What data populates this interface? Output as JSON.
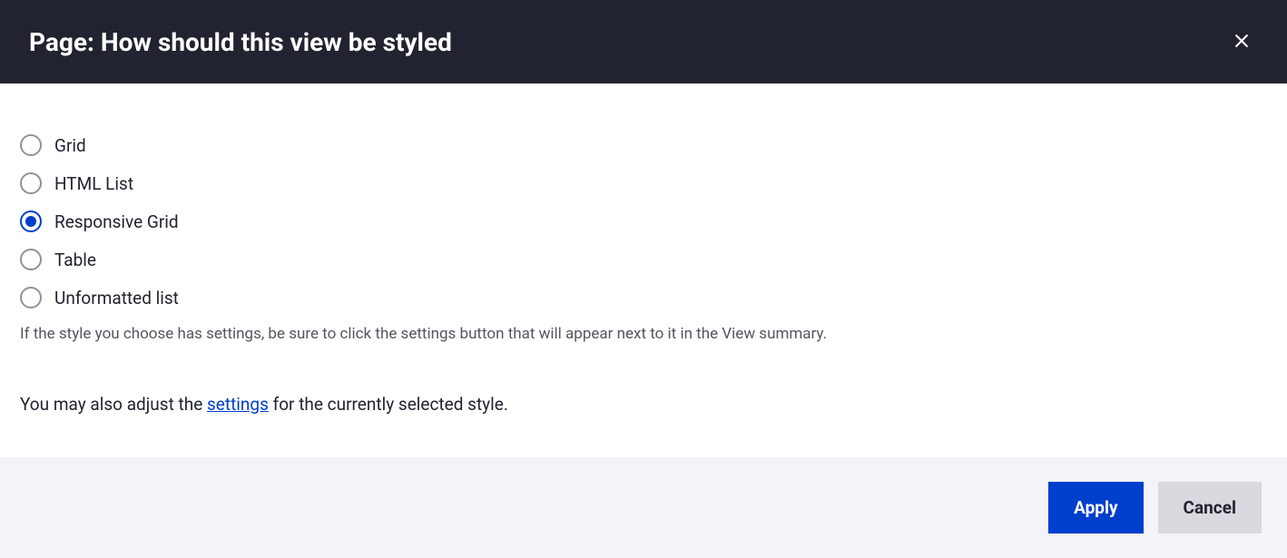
{
  "header": {
    "title": "Page: How should this view be styled"
  },
  "options": [
    {
      "label": "Grid",
      "selected": false
    },
    {
      "label": "HTML List",
      "selected": false
    },
    {
      "label": "Responsive Grid",
      "selected": true
    },
    {
      "label": "Table",
      "selected": false
    },
    {
      "label": "Unformatted list",
      "selected": false
    }
  ],
  "help_text": "If the style you choose has settings, be sure to click the settings button that will appear next to it in the View summary.",
  "settings_sentence": {
    "before": "You may also adjust the ",
    "link": "settings",
    "after": " for the currently selected style."
  },
  "buttons": {
    "apply": "Apply",
    "cancel": "Cancel"
  }
}
